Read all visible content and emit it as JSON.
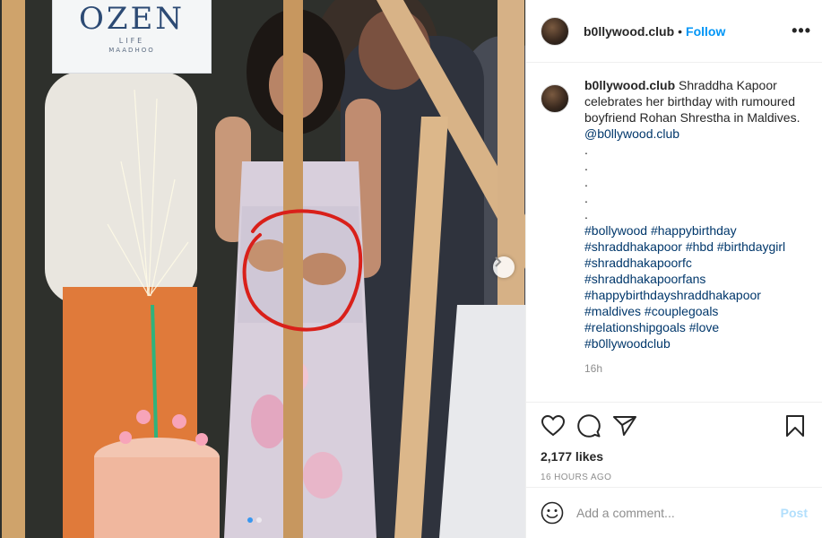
{
  "media": {
    "sign_brand": "OZEN",
    "sign_sub": "LIFE",
    "sign_sub2": "MAADHOO",
    "carousel_dots": 2,
    "active_dot": 0
  },
  "header": {
    "username": "b0llywood.club",
    "separator": "•",
    "follow_label": "Follow",
    "more_label": "•••"
  },
  "caption": {
    "username": "b0llywood.club",
    "text": "Shraddha Kapoor celebrates her birthday with rumoured boyfriend Rohan Shrestha in Maldives.",
    "mention": "@b0llywood.club",
    "dots": [
      ".",
      ".",
      ".",
      ".",
      "."
    ],
    "hashtag_lines": [
      "#bollywood #happybirthday",
      "#shraddhakapoor #hbd #birthdaygirl",
      "#shraddhakapoorfc",
      "#shraddhakapoorfans",
      "#happybirthdayshraddhakapoor",
      "#maldives #couplegoals",
      "#relationshipgoals #love",
      "#b0llywoodclub"
    ],
    "time": "16h"
  },
  "actions": {
    "icons": [
      "heart-icon",
      "comment-icon",
      "share-icon",
      "bookmark-icon"
    ],
    "likes": "2,177 likes",
    "age": "16 HOURS AGO"
  },
  "comment": {
    "placeholder": "Add a comment...",
    "post_label": "Post"
  },
  "colors": {
    "follow": "#0095f6",
    "hashtag": "#00376b",
    "post_disabled": "#b2dffc",
    "muted": "#8e8e8e",
    "annotation_circle": "#d9201a"
  }
}
